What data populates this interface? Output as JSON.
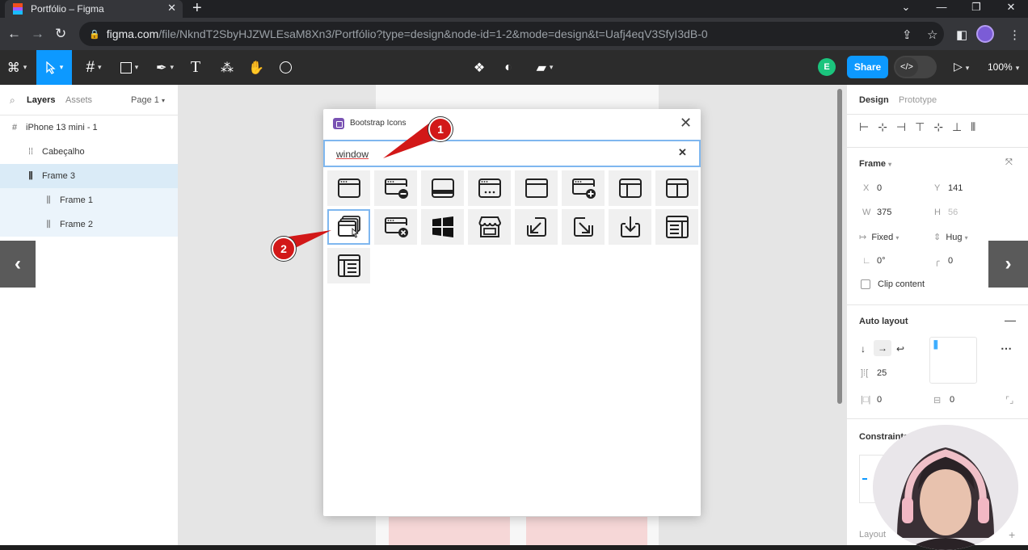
{
  "browser": {
    "tab_title": "Portfólio – Figma",
    "tab_close": "✕",
    "new_tab": "+",
    "url_host": "figma.com",
    "url_path": "/file/NkndT2SbyHJZWLEsaM8Xn3/Portfólio?type=design&node-id=1-2&mode=design&t=Uafj4eqV3SfyI3dB-0"
  },
  "toolbar": {
    "avatar_initial": "E",
    "share_label": "Share",
    "zoom_label": "100%",
    "accent_color": "#0d99ff"
  },
  "left_panel": {
    "tab_layers": "Layers",
    "tab_assets": "Assets",
    "page_selector": "Page 1",
    "layers": [
      {
        "name": "iPhone 13 mini - 1",
        "icon": "frame-icon"
      },
      {
        "name": "Cabeçalho",
        "icon": "auto-layout-icon"
      },
      {
        "name": "Frame 3",
        "icon": "auto-layout-vertical-icon"
      },
      {
        "name": "Frame 1",
        "icon": "auto-layout-vertical-icon"
      },
      {
        "name": "Frame 2",
        "icon": "auto-layout-vertical-icon"
      }
    ]
  },
  "dialog": {
    "title": "Bootstrap Icons",
    "search_value": "window",
    "close": "✕",
    "clear": "✕",
    "results": [
      "window-icon",
      "window-dash-icon",
      "window-dock-icon",
      "window-stack-dots-icon",
      "window-fullscreen-icon",
      "window-plus-icon",
      "window-sidebar-icon",
      "window-split-icon",
      "window-stack-icon",
      "window-x-icon",
      "windows-logo-icon",
      "shop-window-icon",
      "box-arrow-in-down-left-icon",
      "box-arrow-in-down-right-icon",
      "box-arrow-in-down-icon",
      "layout-text-window-icon",
      "layout-text-window-reverse-icon"
    ]
  },
  "right_panel": {
    "tab_design": "Design",
    "tab_prototype": "Prototype",
    "frame_label": "Frame",
    "x_label": "X",
    "x_value": "0",
    "y_label": "Y",
    "y_value": "141",
    "w_label": "W",
    "w_value": "375",
    "h_label": "H",
    "h_value": "56",
    "width_mode": "Fixed",
    "height_mode": "Hug",
    "rotation": "0°",
    "radius": "0",
    "clip_content": "Clip content",
    "auto_layout": "Auto layout",
    "gap": "25",
    "padding_h": "0",
    "padding_v": "0",
    "constraints": "Constraints",
    "layout_grid": "Layout"
  },
  "annotations": {
    "marker1": "1",
    "marker2": "2"
  }
}
